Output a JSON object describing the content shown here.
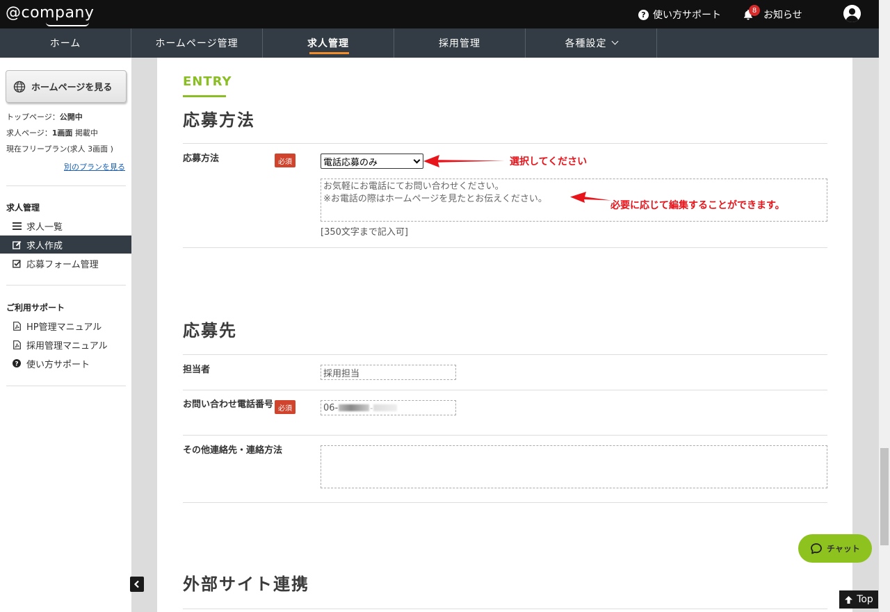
{
  "header": {
    "logo_text": "@company",
    "help_label": "使い方サポート",
    "notifications_label": "お知らせ",
    "notifications_count": "8"
  },
  "nav": {
    "items": [
      {
        "label": "ホーム"
      },
      {
        "label": "ホームページ管理"
      },
      {
        "label": "求人管理"
      },
      {
        "label": "採用管理"
      },
      {
        "label": "各種設定"
      }
    ],
    "active_index": 2
  },
  "sidebar": {
    "view_homepage_button": "ホームページを見る",
    "top_page_label": "トップページ：",
    "top_page_status": "公開中",
    "job_page_label": "求人ページ：",
    "job_page_value": "1画面",
    "job_page_status": "掲載中",
    "plan_text": "現在フリープラン(求人 3画面 )",
    "other_plan_link": "別のプランを見る",
    "section1_title": "求人管理",
    "section1_items": [
      {
        "label": "求人一覧",
        "icon": "list-icon"
      },
      {
        "label": "求人作成",
        "icon": "edit-icon"
      },
      {
        "label": "応募フォーム管理",
        "icon": "checkbox-icon"
      }
    ],
    "section2_title": "ご利用サポート",
    "section2_items": [
      {
        "label": "HP管理マニュアル",
        "icon": "pdf-icon"
      },
      {
        "label": "採用管理マニュアル",
        "icon": "pdf-icon"
      },
      {
        "label": "使い方サポート",
        "icon": "question-icon"
      }
    ]
  },
  "content": {
    "entry_label": "ENTRY",
    "section1_title": "応募方法",
    "method_label": "応募方法",
    "required_badge": "必須",
    "method_select_value": "電話応募のみ",
    "annotation_select": "選択してください",
    "message_line1": "お気軽にお電話にてお問い合わせください。",
    "message_line2": "※お電話の際はホームページを見たとお伝えください。",
    "annotation_edit": "必要に応じて編集することができます。",
    "char_limit_note": "[350文字まで記入可]",
    "section2_title": "応募先",
    "contact_person_label": "担当者",
    "contact_person_value": "採用担当",
    "phone_label": "お問い合わせ電話番号",
    "phone_value_prefix": "06-",
    "other_contact_label": "その他連絡先・連絡方法",
    "other_contact_value": "",
    "section3_title": "外部サイト連携"
  },
  "floating": {
    "chat_label": "チャット",
    "top_label": "Top"
  },
  "colors": {
    "accent_green": "#8bbd26",
    "nav_bg": "#333c44",
    "active_underline": "#f28c28",
    "required_red": "#d0432c",
    "annotation_red": "#e8141b"
  }
}
